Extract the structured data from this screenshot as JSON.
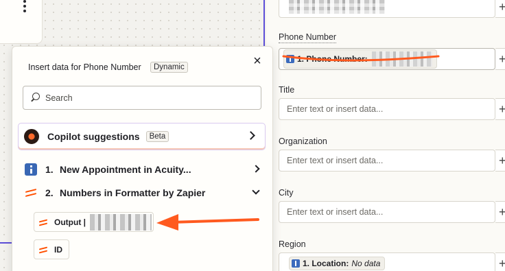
{
  "form": {
    "phone_label": "Phone Number",
    "phone_pill_label": "1. Phone Number:",
    "title_label": "Title",
    "title_placeholder": "Enter text or insert data...",
    "org_label": "Organization",
    "org_placeholder": "Enter text or insert data...",
    "city_label": "City",
    "city_placeholder": "Enter text or insert data...",
    "region_label": "Region",
    "region_pill_label": "1. Location:",
    "region_pill_value": "No data",
    "plus": "+"
  },
  "popup": {
    "title": "Insert data for Phone Number",
    "tag": "Dynamic",
    "close": "×",
    "search_placeholder": "Search",
    "copilot_label": "Copilot suggestions",
    "copilot_badge": "Beta",
    "steps": [
      {
        "num": "1.",
        "label": "New Appointment in Acuity...",
        "icon": "acuity-icon",
        "expanded": false
      },
      {
        "num": "2.",
        "label": "Numbers in Formatter by Zapier",
        "icon": "formatter-icon",
        "expanded": true
      }
    ],
    "outputs": [
      {
        "label": "Output |"
      },
      {
        "label": "ID"
      }
    ]
  },
  "colors": {
    "annotation": "#ff5a1f",
    "accent": "#5b4dd8",
    "brand_orange": "#ff4f00"
  }
}
